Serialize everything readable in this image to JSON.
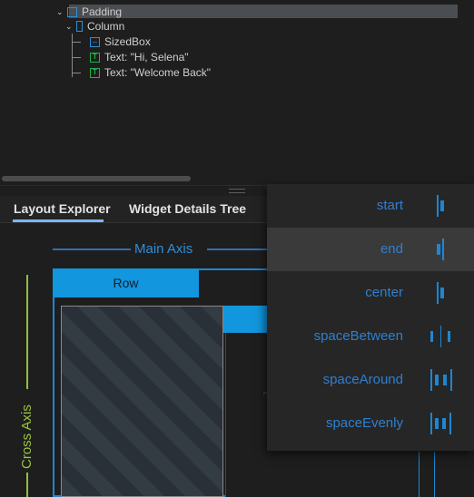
{
  "tree": {
    "items": [
      {
        "label": "Padding",
        "icon": "padding-widget-icon"
      },
      {
        "label": "Column",
        "icon": "column-widget-icon"
      },
      {
        "label": "SizedBox",
        "icon": "sizedbox-widget-icon",
        "icon_glyph": "↔"
      },
      {
        "label": "Text: \"Hi, Selena\"",
        "icon": "text-widget-icon",
        "icon_glyph": "T"
      },
      {
        "label": "Text: \"Welcome Back\"",
        "icon": "text-widget-icon",
        "icon_glyph": "T"
      }
    ],
    "selected_index": 0
  },
  "tabs": [
    {
      "label": "Layout Explorer",
      "active": true
    },
    {
      "label": "Widget Details Tree",
      "active": false
    }
  ],
  "explorer": {
    "main_axis_label": "Main Axis",
    "cross_axis_label": "Cross Axis",
    "row_label": "Row"
  },
  "dropdown": {
    "items": [
      {
        "label": "start",
        "icon": "main-axis-start-icon"
      },
      {
        "label": "end",
        "icon": "main-axis-end-icon",
        "selected": true
      },
      {
        "label": "center",
        "icon": "main-axis-center-icon"
      },
      {
        "label": "spaceBetween",
        "icon": "main-axis-space-between-icon"
      },
      {
        "label": "spaceAround",
        "icon": "main-axis-space-around-icon"
      },
      {
        "label": "spaceEvenly",
        "icon": "main-axis-space-evenly-icon"
      }
    ]
  },
  "colors": {
    "accent_blue": "#1296de",
    "cross_axis_green": "#9bc53d",
    "text_widget_green": "#20b24a",
    "selection_bg": "#4a4d51"
  }
}
